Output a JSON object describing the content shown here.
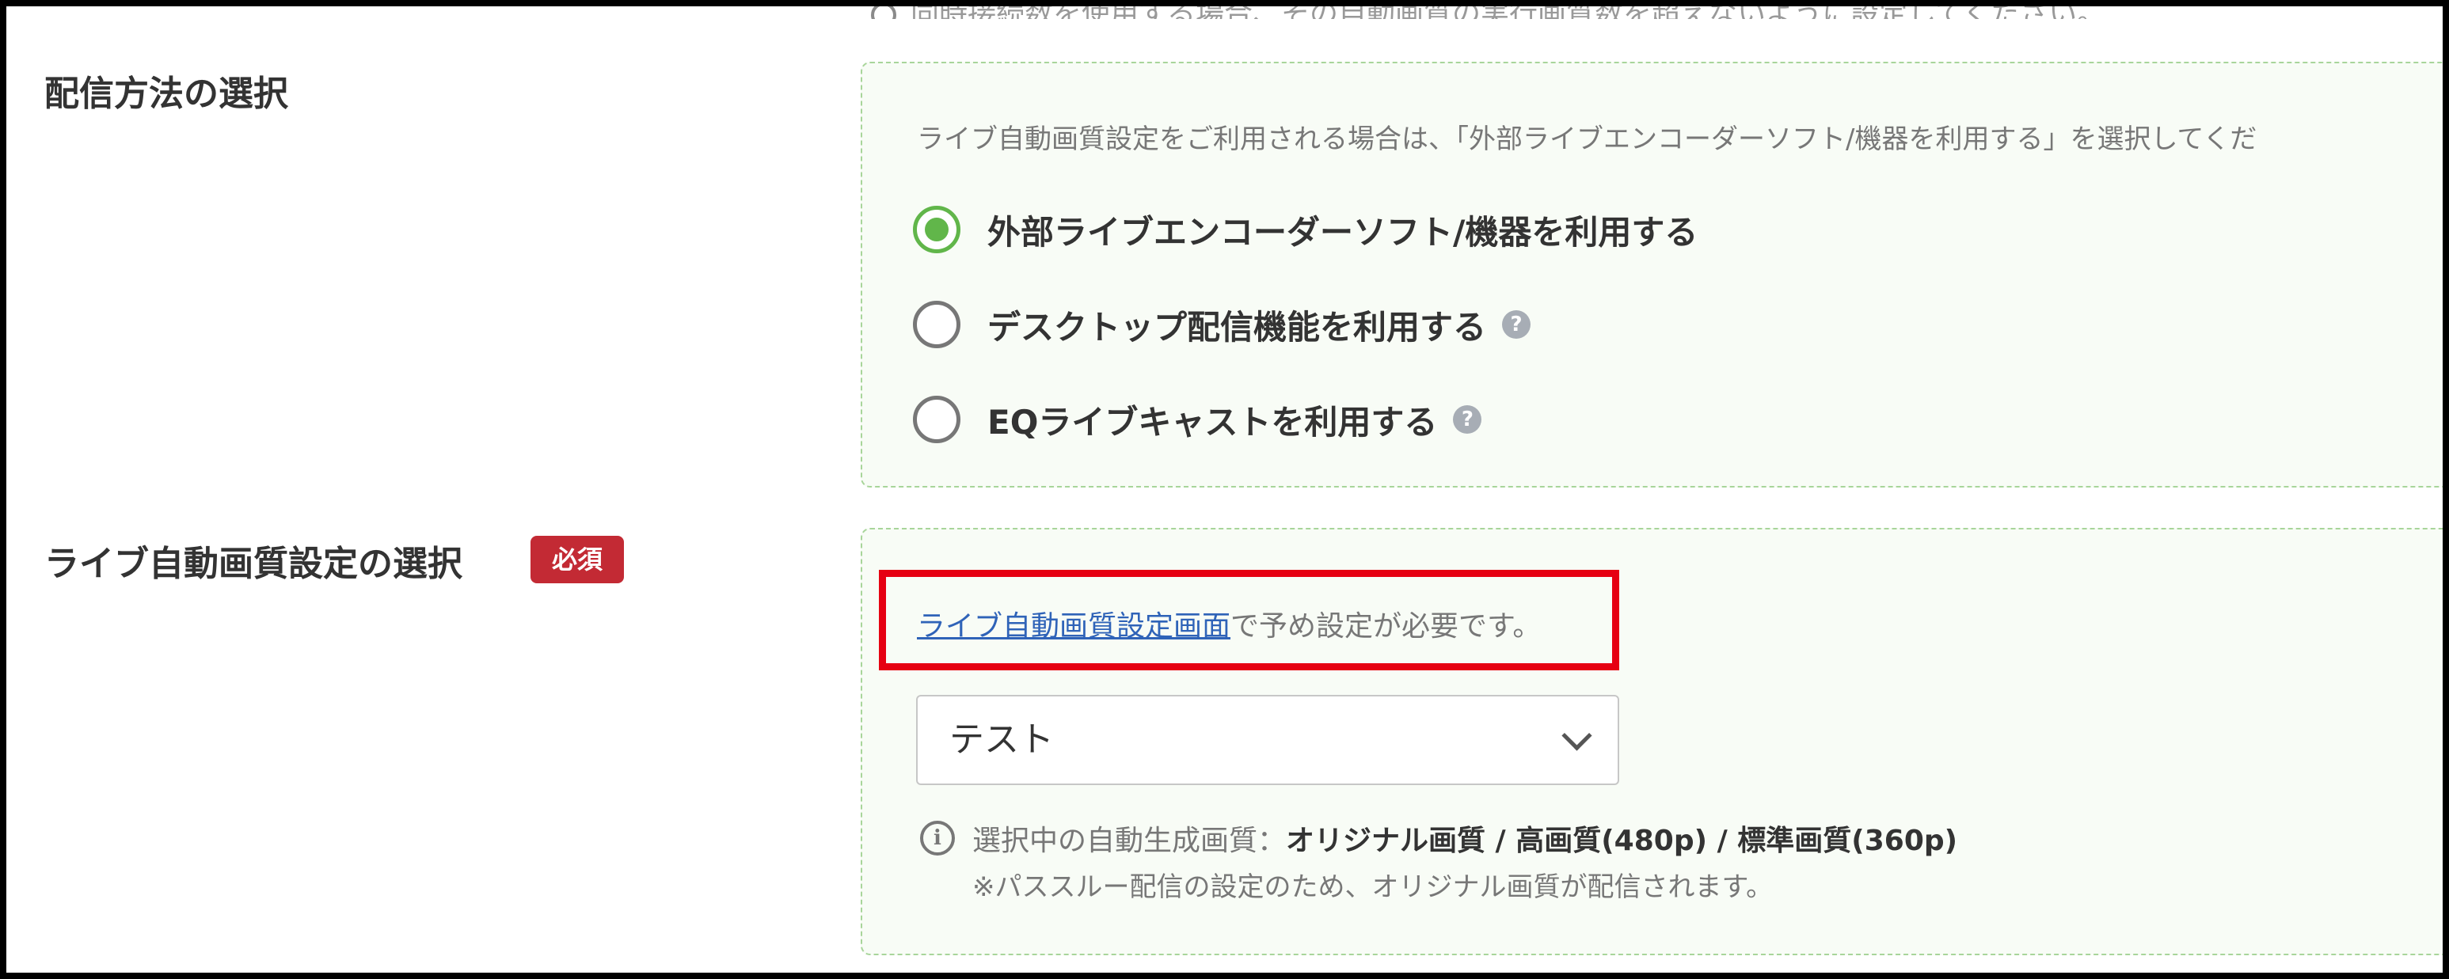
{
  "top_cut_text": "同時接続数を使用する場合、その自動画質の実行画質数を超えないように設定してください。",
  "delivery_method": {
    "label": "配信方法の選択",
    "note": "ライブ自動画質設定をご利用される場合は、「外部ライブエンコーダーソフト/機器を利用する」を選択してくだ",
    "options": [
      {
        "label": "外部ライブエンコーダーソフト/機器を利用する",
        "checked": true,
        "help": false
      },
      {
        "label": "デスクトップ配信機能を利用する",
        "checked": false,
        "help": true
      },
      {
        "label": "EQライブキャストを利用する",
        "checked": false,
        "help": true
      }
    ],
    "help_glyph": "?"
  },
  "auto_quality": {
    "label": "ライブ自動画質設定の選択",
    "required_badge": "必須",
    "link_text": "ライブ自動画質設定画面",
    "link_suffix": "で予め設定が必要です。",
    "select_value": "テスト",
    "info_icon_glyph": "i",
    "info_label": "選択中の自動生成画質：",
    "info_value": "オリジナル画質 / 高画質(480p) / 標準画質(360p)",
    "info_sub": "※パススルー配信の設定のため、オリジナル画質が配信されます。"
  },
  "colors": {
    "accent_green": "#61b64a",
    "required_red": "#c32a34",
    "link_blue": "#2f63b8",
    "highlight_red": "#e60012",
    "panel_border": "#a8d59a"
  }
}
